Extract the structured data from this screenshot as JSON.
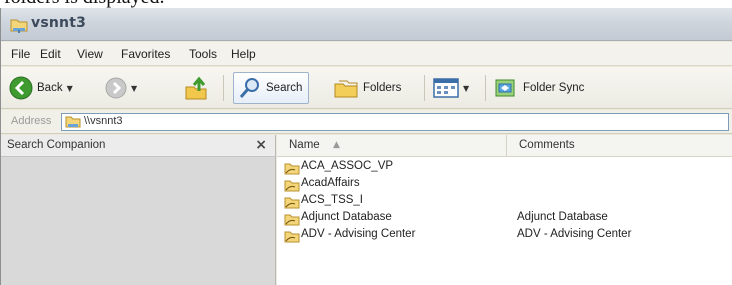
{
  "doc_text": "folders is displayed.",
  "window": {
    "title": "vsnnt3"
  },
  "menu": [
    "File",
    "Edit",
    "View",
    "Favorites",
    "Tools",
    "Help"
  ],
  "toolbar": {
    "back": "Back",
    "search": "Search",
    "folders": "Folders",
    "folder_sync": "Folder Sync"
  },
  "address": {
    "label": "Address",
    "value": "\\\\vsnnt3"
  },
  "companion": {
    "title": "Search Companion",
    "close": "×"
  },
  "columns": {
    "name": "Name",
    "comments": "Comments",
    "sort_indicator": "▲"
  },
  "files": [
    {
      "name": "ACA_ASSOC_VP",
      "comment": ""
    },
    {
      "name": "AcadAffairs",
      "comment": ""
    },
    {
      "name": "ACS_TSS_I",
      "comment": ""
    },
    {
      "name": "Adjunct Database",
      "comment": "Adjunct Database"
    },
    {
      "name": "ADV - Advising Center",
      "comment": "ADV - Advising Center"
    }
  ],
  "icons": {
    "window": "network-folder-icon",
    "back": "back-arrow-icon",
    "forward": "forward-arrow-icon",
    "up": "up-folder-icon",
    "search": "search-magnifier-icon",
    "folders": "folders-icon",
    "views": "views-icon",
    "folder_sync": "folder-sync-icon",
    "share": "shared-folder-icon"
  },
  "colors": {
    "titlebar": "#cfd5dd",
    "chrome": "#ece9d8",
    "companion_bg": "#d9d9d9",
    "accent_green": "#3f9b2f"
  }
}
